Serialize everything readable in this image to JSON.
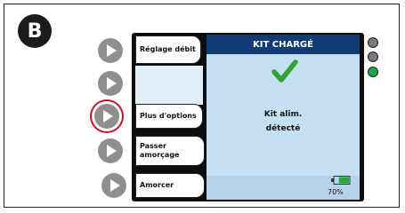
{
  "badge": {
    "label": "B"
  },
  "side_buttons": [
    {
      "label": "Réglage débit"
    },
    {
      "label": "Plus d'options"
    },
    {
      "label": "Passer amorçage"
    },
    {
      "label": "Amorcer"
    }
  ],
  "screen": {
    "header": "KIT CHARGÉ",
    "message_line1": "Kit alim.",
    "message_line2": "détecté",
    "battery_percent": "70%",
    "battery_level": 0.7
  },
  "indicator_lights": [
    {
      "state": "off",
      "color": "#7a7a7a"
    },
    {
      "state": "off",
      "color": "#7a7a7a"
    },
    {
      "state": "on",
      "color": "#1aa64a"
    }
  ],
  "colors": {
    "header_bg": "#123a73",
    "screen_bg": "#c6e0f3",
    "selection_ring": "#c8102e",
    "checkmark": "#2fa32f"
  },
  "icons": [
    "play-icon",
    "check-icon",
    "battery-icon"
  ]
}
